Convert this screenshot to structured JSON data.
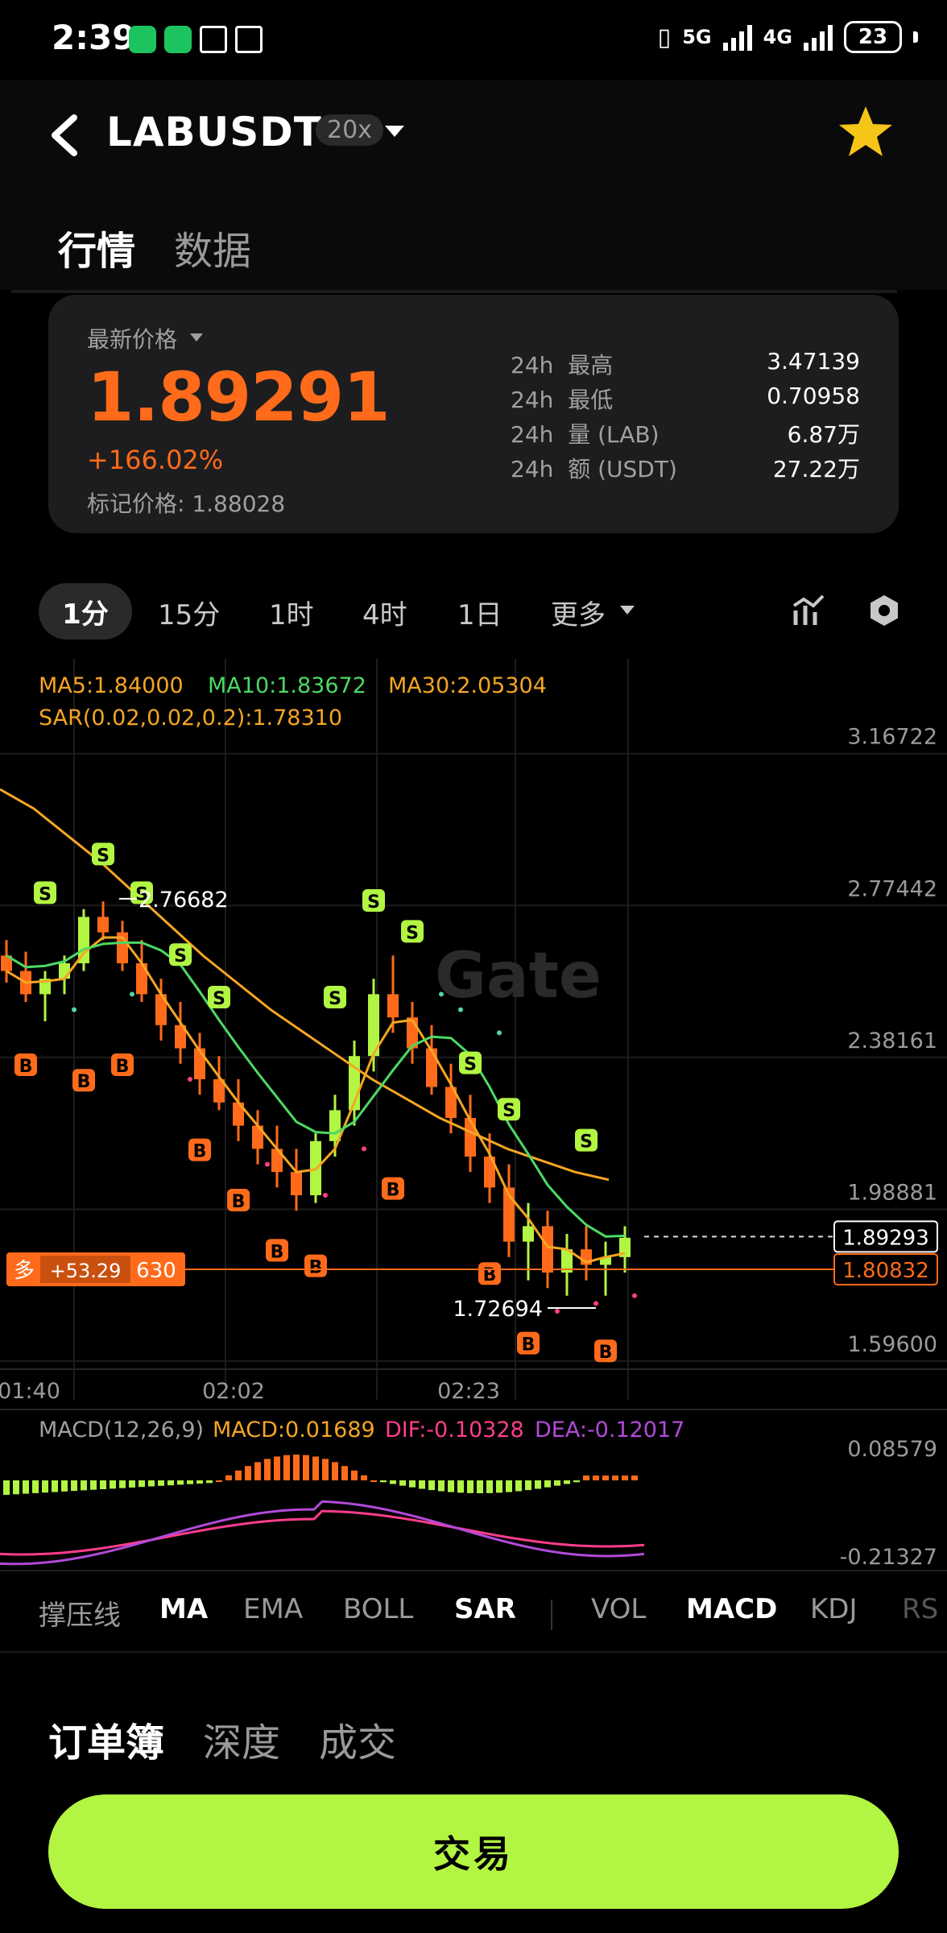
{
  "status_bar": {
    "time": "2:39",
    "network_5g": "5G",
    "network_4g": "4G",
    "battery": "23"
  },
  "header": {
    "pair": "LABUSDT",
    "leverage": "20x"
  },
  "tabs": [
    "行情",
    "数据"
  ],
  "ticker": {
    "latest_label": "最新价格",
    "price": "1.89291",
    "change": "+166.02%",
    "mark_label": "标记价格:",
    "mark_price": "1.88028",
    "stats": [
      {
        "period": "24h",
        "label": "最高",
        "value": "3.47139"
      },
      {
        "period": "24h",
        "label": "最低",
        "value": "0.70958"
      },
      {
        "period": "24h",
        "label": "量 (LAB)",
        "value": "6.87万"
      },
      {
        "period": "24h",
        "label": "额 (USDT)",
        "value": "27.22万"
      }
    ]
  },
  "intervals": [
    "1分",
    "15分",
    "1时",
    "4时",
    "1日",
    "更多"
  ],
  "indicators": {
    "ma5": "MA5:1.84000",
    "ma10": "MA10:1.83672",
    "ma30": "MA30:2.05304",
    "sar": "SAR(0.02,0.02,0.2):1.78310",
    "macd_title": "MACD(12,26,9)",
    "macd_val": "MACD:0.01689",
    "dif": "DIF:-0.10328",
    "dea": "DEA:-0.12017"
  },
  "price_axis": [
    "3.16722",
    "2.77442",
    "2.38161",
    "1.98881",
    "1.59600"
  ],
  "current_price_tag": "1.89293",
  "position_price_tag": "1.80832",
  "high_label": "2.76682",
  "low_label": "1.72694",
  "position": {
    "side": "多",
    "pnl": "+53.29",
    "qty": "630"
  },
  "watermark": "Gate",
  "time_axis": [
    "01:40",
    "02:02",
    "02:23"
  ],
  "macd_axis": [
    "0.08579",
    "-0.21327"
  ],
  "marker_sell": "S",
  "marker_buy": "B",
  "indicator_tabs": [
    "撑压线",
    "MA",
    "EMA",
    "BOLL",
    "SAR",
    "VOL",
    "MACD",
    "KDJ",
    "RS"
  ],
  "book_tabs": [
    "订单簿",
    "深度",
    "成交"
  ],
  "trade_button": "交易",
  "colors": {
    "accent_orange": "#ff6b1a",
    "up_green": "#b2f542",
    "ma5": "#f5a623",
    "ma10": "#4cd964",
    "ma30": "#f5a623",
    "dif": "#ff3d8b",
    "dea": "#b14ad8"
  },
  "chart_data": {
    "type": "candlestick",
    "title": "",
    "x_ticks": [
      "01:40",
      "02:02",
      "02:23"
    ],
    "y_ticks": [
      3.16722,
      2.77442,
      2.38161,
      1.98881,
      1.596
    ],
    "ylim": [
      1.596,
      3.16722
    ],
    "high": 2.76682,
    "low": 1.72694,
    "current": 1.89293,
    "position_price": 1.80832,
    "ma30_series": [
      3.05,
      3.0,
      2.93,
      2.86,
      2.78,
      2.7,
      2.62,
      2.55,
      2.48,
      2.42,
      2.36,
      2.3,
      2.25,
      2.2,
      2.16,
      2.12,
      2.09,
      2.06,
      2.04
    ],
    "candles": [
      [
        2.62,
        2.66,
        2.55,
        2.58
      ],
      [
        2.58,
        2.63,
        2.5,
        2.52
      ],
      [
        2.52,
        2.58,
        2.45,
        2.56
      ],
      [
        2.56,
        2.62,
        2.52,
        2.6
      ],
      [
        2.6,
        2.74,
        2.58,
        2.72
      ],
      [
        2.72,
        2.76,
        2.66,
        2.68
      ],
      [
        2.68,
        2.71,
        2.58,
        2.6
      ],
      [
        2.6,
        2.66,
        2.5,
        2.52
      ],
      [
        2.52,
        2.56,
        2.4,
        2.44
      ],
      [
        2.44,
        2.5,
        2.34,
        2.38
      ],
      [
        2.38,
        2.42,
        2.26,
        2.3
      ],
      [
        2.3,
        2.36,
        2.22,
        2.24
      ],
      [
        2.24,
        2.3,
        2.14,
        2.18
      ],
      [
        2.18,
        2.22,
        2.08,
        2.12
      ],
      [
        2.12,
        2.18,
        2.02,
        2.06
      ],
      [
        2.06,
        2.12,
        1.96,
        2.0
      ],
      [
        2.0,
        2.16,
        1.98,
        2.14
      ],
      [
        2.14,
        2.26,
        2.1,
        2.22
      ],
      [
        2.22,
        2.4,
        2.18,
        2.36
      ],
      [
        2.36,
        2.56,
        2.32,
        2.52
      ],
      [
        2.52,
        2.62,
        2.42,
        2.46
      ],
      [
        2.46,
        2.5,
        2.34,
        2.38
      ],
      [
        2.38,
        2.44,
        2.26,
        2.28
      ],
      [
        2.28,
        2.34,
        2.16,
        2.2
      ],
      [
        2.2,
        2.26,
        2.06,
        2.1
      ],
      [
        2.1,
        2.16,
        1.98,
        2.02
      ],
      [
        2.02,
        2.08,
        1.84,
        1.88
      ],
      [
        1.88,
        1.98,
        1.78,
        1.92
      ],
      [
        1.92,
        1.96,
        1.76,
        1.8
      ],
      [
        1.8,
        1.9,
        1.74,
        1.86
      ],
      [
        1.86,
        1.92,
        1.78,
        1.82
      ],
      [
        1.82,
        1.88,
        1.74,
        1.84
      ],
      [
        1.84,
        1.92,
        1.8,
        1.89
      ]
    ]
  }
}
